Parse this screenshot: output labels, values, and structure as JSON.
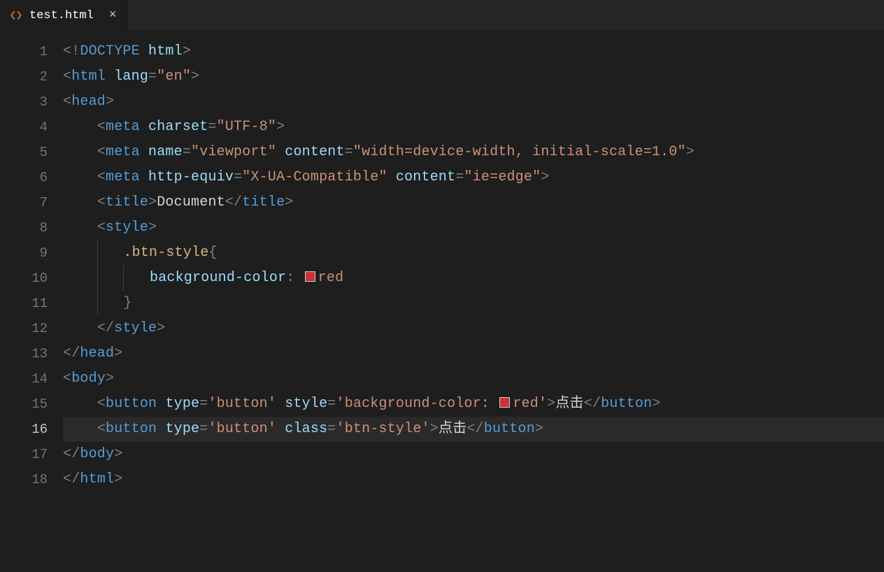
{
  "tab": {
    "filename": "test.html",
    "close_label": "×"
  },
  "line_numbers": [
    "1",
    "2",
    "3",
    "4",
    "5",
    "6",
    "7",
    "8",
    "9",
    "10",
    "11",
    "12",
    "13",
    "14",
    "15",
    "16",
    "17",
    "18"
  ],
  "active_line": "16",
  "colors": {
    "red_swatch": "#cc3333"
  },
  "lines": [
    {
      "indent": 0,
      "tokens": [
        {
          "t": "angle",
          "v": "<!"
        },
        {
          "t": "doctype",
          "v": "DOCTYPE"
        },
        {
          "t": "text",
          "v": " "
        },
        {
          "t": "attr",
          "v": "html"
        },
        {
          "t": "angle",
          "v": ">"
        }
      ]
    },
    {
      "indent": 0,
      "tokens": [
        {
          "t": "angle",
          "v": "<"
        },
        {
          "t": "tag",
          "v": "html"
        },
        {
          "t": "text",
          "v": " "
        },
        {
          "t": "attr",
          "v": "lang"
        },
        {
          "t": "punct",
          "v": "="
        },
        {
          "t": "string",
          "v": "\"en\""
        },
        {
          "t": "angle",
          "v": ">"
        }
      ]
    },
    {
      "indent": 0,
      "tokens": [
        {
          "t": "angle",
          "v": "<"
        },
        {
          "t": "tag",
          "v": "head"
        },
        {
          "t": "angle",
          "v": ">"
        }
      ]
    },
    {
      "indent": 1,
      "tokens": [
        {
          "t": "angle",
          "v": "<"
        },
        {
          "t": "tag",
          "v": "meta"
        },
        {
          "t": "text",
          "v": " "
        },
        {
          "t": "attr",
          "v": "charset"
        },
        {
          "t": "punct",
          "v": "="
        },
        {
          "t": "string",
          "v": "\"UTF-8\""
        },
        {
          "t": "angle",
          "v": ">"
        }
      ]
    },
    {
      "indent": 1,
      "tokens": [
        {
          "t": "angle",
          "v": "<"
        },
        {
          "t": "tag",
          "v": "meta"
        },
        {
          "t": "text",
          "v": " "
        },
        {
          "t": "attr",
          "v": "name"
        },
        {
          "t": "punct",
          "v": "="
        },
        {
          "t": "string",
          "v": "\"viewport\""
        },
        {
          "t": "text",
          "v": " "
        },
        {
          "t": "attr",
          "v": "content"
        },
        {
          "t": "punct",
          "v": "="
        },
        {
          "t": "string",
          "v": "\"width=device-width, initial-scale=1.0\""
        },
        {
          "t": "angle",
          "v": ">"
        }
      ]
    },
    {
      "indent": 1,
      "tokens": [
        {
          "t": "angle",
          "v": "<"
        },
        {
          "t": "tag",
          "v": "meta"
        },
        {
          "t": "text",
          "v": " "
        },
        {
          "t": "attr",
          "v": "http-equiv"
        },
        {
          "t": "punct",
          "v": "="
        },
        {
          "t": "string",
          "v": "\"X-UA-Compatible\""
        },
        {
          "t": "text",
          "v": " "
        },
        {
          "t": "attr",
          "v": "content"
        },
        {
          "t": "punct",
          "v": "="
        },
        {
          "t": "string",
          "v": "\"ie=edge\""
        },
        {
          "t": "angle",
          "v": ">"
        }
      ]
    },
    {
      "indent": 1,
      "tokens": [
        {
          "t": "angle",
          "v": "<"
        },
        {
          "t": "tag",
          "v": "title"
        },
        {
          "t": "angle",
          "v": ">"
        },
        {
          "t": "text",
          "v": "Document"
        },
        {
          "t": "angle",
          "v": "</"
        },
        {
          "t": "tag",
          "v": "title"
        },
        {
          "t": "angle",
          "v": ">"
        }
      ]
    },
    {
      "indent": 1,
      "tokens": [
        {
          "t": "angle",
          "v": "<"
        },
        {
          "t": "tag",
          "v": "style"
        },
        {
          "t": "angle",
          "v": ">"
        }
      ]
    },
    {
      "indent": 2,
      "tokens": [
        {
          "t": "selector",
          "v": ".btn-style"
        },
        {
          "t": "punct",
          "v": "{"
        }
      ]
    },
    {
      "indent": 3,
      "tokens": [
        {
          "t": "prop",
          "v": "background-color"
        },
        {
          "t": "punct",
          "v": ":"
        },
        {
          "t": "swatch",
          "v": "red"
        },
        {
          "t": "value",
          "v": "red"
        }
      ]
    },
    {
      "indent": 2,
      "tokens": [
        {
          "t": "punct",
          "v": "}"
        }
      ]
    },
    {
      "indent": 1,
      "tokens": [
        {
          "t": "angle",
          "v": "</"
        },
        {
          "t": "tag",
          "v": "style"
        },
        {
          "t": "angle",
          "v": ">"
        }
      ]
    },
    {
      "indent": 0,
      "tokens": [
        {
          "t": "angle",
          "v": "</"
        },
        {
          "t": "tag",
          "v": "head"
        },
        {
          "t": "angle",
          "v": ">"
        }
      ]
    },
    {
      "indent": 0,
      "tokens": [
        {
          "t": "angle",
          "v": "<"
        },
        {
          "t": "tag",
          "v": "body"
        },
        {
          "t": "angle",
          "v": ">"
        }
      ]
    },
    {
      "indent": 1,
      "tokens": [
        {
          "t": "angle",
          "v": "<"
        },
        {
          "t": "tag",
          "v": "button"
        },
        {
          "t": "text",
          "v": " "
        },
        {
          "t": "attr",
          "v": "type"
        },
        {
          "t": "punct",
          "v": "="
        },
        {
          "t": "string",
          "v": "'button'"
        },
        {
          "t": "text",
          "v": " "
        },
        {
          "t": "attr",
          "v": "style"
        },
        {
          "t": "punct",
          "v": "="
        },
        {
          "t": "string",
          "v": "'background-color:"
        },
        {
          "t": "swatch",
          "v": "red"
        },
        {
          "t": "string",
          "v": "red'"
        },
        {
          "t": "angle",
          "v": ">"
        },
        {
          "t": "text",
          "v": "点击"
        },
        {
          "t": "angle",
          "v": "</"
        },
        {
          "t": "tag",
          "v": "button"
        },
        {
          "t": "angle",
          "v": ">"
        }
      ]
    },
    {
      "indent": 1,
      "tokens": [
        {
          "t": "angle",
          "v": "<"
        },
        {
          "t": "tag",
          "v": "button"
        },
        {
          "t": "text",
          "v": " "
        },
        {
          "t": "attr",
          "v": "type"
        },
        {
          "t": "punct",
          "v": "="
        },
        {
          "t": "string",
          "v": "'button'"
        },
        {
          "t": "text",
          "v": " "
        },
        {
          "t": "attr",
          "v": "class"
        },
        {
          "t": "punct",
          "v": "="
        },
        {
          "t": "string",
          "v": "'btn-style'"
        },
        {
          "t": "angle",
          "v": ">"
        },
        {
          "t": "text",
          "v": "点击"
        },
        {
          "t": "angle",
          "v": "</"
        },
        {
          "t": "tag",
          "v": "button"
        },
        {
          "t": "angle",
          "v": ">"
        }
      ]
    },
    {
      "indent": 0,
      "tokens": [
        {
          "t": "angle",
          "v": "</"
        },
        {
          "t": "tag",
          "v": "body"
        },
        {
          "t": "angle",
          "v": ">"
        }
      ]
    },
    {
      "indent": 0,
      "tokens": [
        {
          "t": "angle",
          "v": "</"
        },
        {
          "t": "tag",
          "v": "html"
        },
        {
          "t": "angle",
          "v": ">"
        }
      ]
    }
  ]
}
